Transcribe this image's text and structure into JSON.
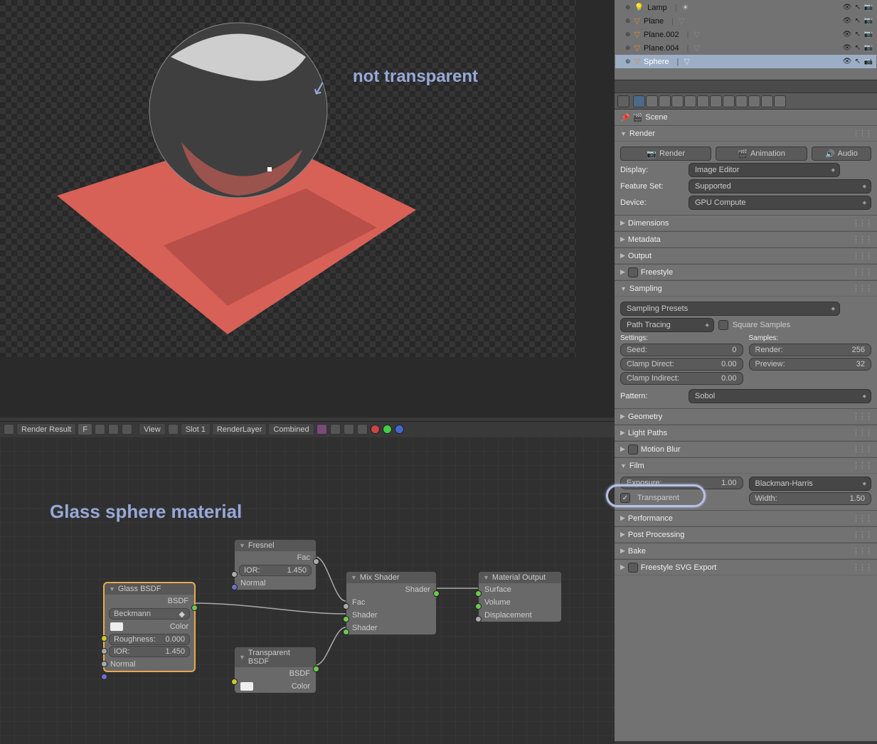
{
  "annotation1": "not transparent",
  "node_editor_title": "Glass sphere material",
  "image_bar": {
    "result": "Render Result",
    "f": "F",
    "view": "View",
    "slot": "Slot 1",
    "layer": "RenderLayer",
    "pass": "Combined"
  },
  "outliner": {
    "items": [
      {
        "name": "Lamp",
        "icon": "lamp-icon"
      },
      {
        "name": "Plane",
        "icon": "mesh-icon"
      },
      {
        "name": "Plane.002",
        "icon": "mesh-icon"
      },
      {
        "name": "Plane.004",
        "icon": "mesh-icon"
      },
      {
        "name": "Sphere",
        "icon": "mesh-icon",
        "selected": true
      }
    ]
  },
  "breadcrumb": "Scene",
  "panels": {
    "render": {
      "title": "Render",
      "render_btn": "Render",
      "anim_btn": "Animation",
      "audio_btn": "Audio",
      "display_lbl": "Display:",
      "display_val": "Image Editor",
      "feature_lbl": "Feature Set:",
      "feature_val": "Supported",
      "device_lbl": "Device:",
      "device_val": "GPU Compute"
    },
    "dimensions": "Dimensions",
    "metadata": "Metadata",
    "output": "Output",
    "freestyle": "Freestyle",
    "sampling": {
      "title": "Sampling",
      "presets": "Sampling Presets",
      "integrator": "Path Tracing",
      "square": "Square Samples",
      "settings": "Settings:",
      "samples": "Samples:",
      "seed_l": "Seed:",
      "seed_v": "0",
      "render_l": "Render:",
      "render_v": "256",
      "clampd_l": "Clamp Direct:",
      "clampd_v": "0.00",
      "preview_l": "Preview:",
      "preview_v": "32",
      "clampi_l": "Clamp Indirect:",
      "clampi_v": "0.00",
      "pattern_l": "Pattern:",
      "pattern_v": "Sobol"
    },
    "geometry": "Geometry",
    "lightpaths": "Light Paths",
    "motionblur": "Motion Blur",
    "film": {
      "title": "Film",
      "exposure_l": "Exposure:",
      "exposure_v": "1.00",
      "filter": "Blackman-Harris",
      "transparent": "Transparent",
      "width_l": "Width:",
      "width_v": "1.50"
    },
    "performance": "Performance",
    "postproc": "Post Processing",
    "bake": "Bake",
    "svgexport": "Freestyle SVG Export"
  },
  "nodes": {
    "glass": {
      "title": "Glass BSDF",
      "bsdf": "BSDF",
      "dist": "Beckmann",
      "color": "Color",
      "rough_l": "Roughness:",
      "rough_v": "0.000",
      "ior_l": "IOR:",
      "ior_v": "1.450",
      "normal": "Normal"
    },
    "fresnel": {
      "title": "Fresnel",
      "fac": "Fac",
      "ior_l": "IOR:",
      "ior_v": "1.450",
      "normal": "Normal"
    },
    "transp": {
      "title": "Transparent BSDF",
      "bsdf": "BSDF",
      "color": "Color"
    },
    "mix": {
      "title": "Mix Shader",
      "shader": "Shader",
      "fac": "Fac",
      "sh1": "Shader",
      "sh2": "Shader"
    },
    "out": {
      "title": "Material Output",
      "surf": "Surface",
      "vol": "Volume",
      "disp": "Displacement"
    }
  }
}
